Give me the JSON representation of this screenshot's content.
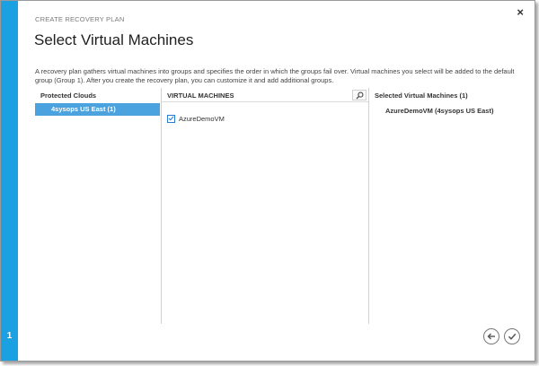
{
  "wizard": {
    "breadcrumb": "CREATE RECOVERY PLAN",
    "title": "Select Virtual Machines",
    "description": "A recovery plan gathers virtual machines into groups and specifies the order in which the groups fail over. Virtual machines you select will be added to the default group (Group 1). After you create the recovery plan, you can customize it and add additional groups.",
    "step_number": "1",
    "close_glyph": "×"
  },
  "clouds": {
    "header": "Protected Clouds",
    "items": [
      {
        "label": "4sysops US East (1)",
        "selected": true
      }
    ]
  },
  "virtual_machines": {
    "header": "VIRTUAL MACHINES",
    "search_icon": "search-icon",
    "items": [
      {
        "label": "AzureDemoVM",
        "checked": true
      }
    ]
  },
  "selected": {
    "header": "Selected Virtual Machines (1)",
    "items": [
      {
        "label": "AzureDemoVM (4sysops US East)"
      }
    ]
  },
  "footer": {
    "back_icon": "arrow-left-icon",
    "confirm_icon": "checkmark-icon"
  },
  "colors": {
    "accent": "#1ba1e2",
    "selection": "#4aa3df",
    "checkbox": "#2b7cd3"
  }
}
